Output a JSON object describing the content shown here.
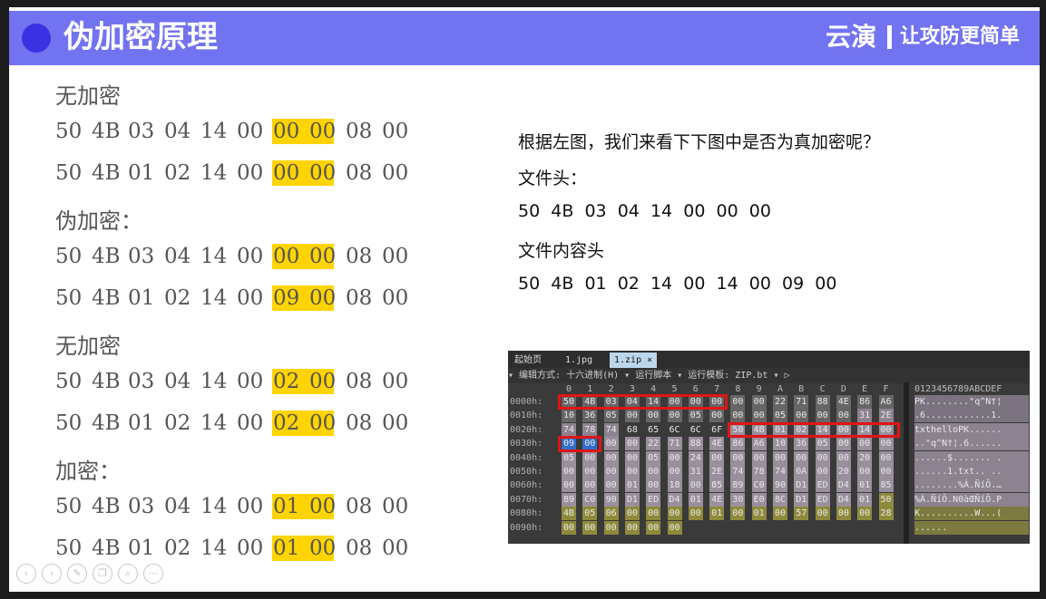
{
  "header": {
    "title": "伪加密原理",
    "brand_name": "云演",
    "brand_slogan": "让攻防更简单"
  },
  "left": {
    "sections": [
      {
        "label": "无加密",
        "lines": [
          {
            "bytes": [
              "50",
              "4B",
              "03",
              "04",
              "14",
              "00",
              "00",
              "00",
              "08",
              "00"
            ]
          },
          {
            "bytes": [
              "50",
              "4B",
              "01",
              "02",
              "14",
              "00",
              "00",
              "00",
              "08",
              "00"
            ]
          }
        ]
      },
      {
        "label": "伪加密：",
        "lines": [
          {
            "bytes": [
              "50",
              "4B",
              "03",
              "04",
              "14",
              "00",
              "00",
              "00",
              "08",
              "00"
            ]
          },
          {
            "bytes": [
              "50",
              "4B",
              "01",
              "02",
              "14",
              "00",
              "09",
              "00",
              "08",
              "00"
            ]
          }
        ]
      },
      {
        "label": "无加密",
        "lines": [
          {
            "bytes": [
              "50",
              "4B",
              "03",
              "04",
              "14",
              "00",
              "02",
              "00",
              "08",
              "00"
            ]
          },
          {
            "bytes": [
              "50",
              "4B",
              "01",
              "02",
              "14",
              "00",
              "02",
              "00",
              "08",
              "00"
            ]
          }
        ]
      },
      {
        "label": "加密：",
        "lines": [
          {
            "bytes": [
              "50",
              "4B",
              "03",
              "04",
              "14",
              "00",
              "01",
              "00",
              "08",
              "00"
            ]
          },
          {
            "bytes": [
              "50",
              "4B",
              "01",
              "02",
              "14",
              "00",
              "01",
              "00",
              "08",
              "00"
            ]
          }
        ]
      }
    ]
  },
  "right": {
    "question": "根据左图，我们来看下下图中是否为真加密呢？",
    "file_header_label": "文件头：",
    "file_header_bytes": "50  4B  03  04  14  00  00  00",
    "file_content_label": "文件内容头",
    "file_content_bytes": "50  4B  01  02  14  00  14  00  09  00"
  },
  "hex_editor": {
    "tabs": [
      "起始页",
      "1.jpg",
      "1.zip"
    ],
    "active_tab": "1.zip",
    "toolbar": "▾  编辑方式: 十六进制(H) ▾   运行脚本 ▾   运行模板: ZIP.bt ▾  ▷",
    "columns": [
      "0",
      "1",
      "2",
      "3",
      "4",
      "5",
      "6",
      "7",
      "8",
      "9",
      "A",
      "B",
      "C",
      "D",
      "E",
      "F"
    ],
    "ascii_header": "0123456789ABCDEF",
    "rows": [
      {
        "offset": "0000h:",
        "bytes": [
          "50",
          "4B",
          "03",
          "04",
          "14",
          "00",
          "00",
          "00",
          "00",
          "00",
          "22",
          "71",
          "88",
          "4E",
          "86",
          "A6"
        ],
        "ascii": "PK........\"q^N†¦"
      },
      {
        "offset": "0010h:",
        "bytes": [
          "10",
          "36",
          "05",
          "00",
          "00",
          "00",
          "05",
          "00",
          "00",
          "00",
          "05",
          "00",
          "00",
          "00",
          "31",
          "2E"
        ],
        "ascii": ".6............1."
      },
      {
        "offset": "0020h:",
        "bytes": [
          "74",
          "78",
          "74",
          "68",
          "65",
          "6C",
          "6C",
          "6F",
          "50",
          "4B",
          "01",
          "02",
          "14",
          "00",
          "14",
          "00"
        ],
        "ascii": "txthelloPK......"
      },
      {
        "offset": "0030h:",
        "bytes": [
          "09",
          "00",
          "00",
          "00",
          "22",
          "71",
          "88",
          "4E",
          "86",
          "A6",
          "10",
          "36",
          "05",
          "00",
          "00",
          "00"
        ],
        "ascii": "..\"q^N†¦.6......"
      },
      {
        "offset": "0040h:",
        "bytes": [
          "05",
          "00",
          "00",
          "00",
          "05",
          "00",
          "24",
          "00",
          "00",
          "00",
          "00",
          "00",
          "00",
          "00",
          "20",
          "00"
        ],
        "ascii": "......$....... ."
      },
      {
        "offset": "0050h:",
        "bytes": [
          "00",
          "00",
          "00",
          "00",
          "00",
          "00",
          "31",
          "2E",
          "74",
          "78",
          "74",
          "0A",
          "00",
          "20",
          "00",
          "00"
        ],
        "ascii": "......1.txt.. .."
      },
      {
        "offset": "0060h:",
        "bytes": [
          "00",
          "00",
          "00",
          "01",
          "00",
          "18",
          "00",
          "85",
          "89",
          "C0",
          "90",
          "D1",
          "ED",
          "D4",
          "01",
          "85"
        ],
        "ascii": "........%À.ÑíÔ.…"
      },
      {
        "offset": "0070h:",
        "bytes": [
          "89",
          "C0",
          "90",
          "D1",
          "ED",
          "D4",
          "01",
          "4E",
          "30",
          "E0",
          "8C",
          "D1",
          "ED",
          "D4",
          "01",
          "50"
        ],
        "ascii": "%À.ÑíÔ.N0àŒÑíÔ.P"
      },
      {
        "offset": "0080h:",
        "bytes": [
          "4B",
          "05",
          "06",
          "00",
          "00",
          "00",
          "00",
          "01",
          "00",
          "01",
          "00",
          "57",
          "00",
          "00",
          "00",
          "28"
        ],
        "ascii": "K..........W...("
      },
      {
        "offset": "0090h:",
        "bytes": [
          "00",
          "00",
          "00",
          "00",
          "00",
          "00"
        ],
        "ascii": "......"
      }
    ]
  },
  "nav_icons": [
    "prev-icon",
    "next-icon",
    "pen-icon",
    "copy-icon",
    "zoom-icon",
    "more-icon"
  ],
  "colors": {
    "header": "#7273f0",
    "highlight": "#ffd400",
    "redbox": "#e01515"
  }
}
